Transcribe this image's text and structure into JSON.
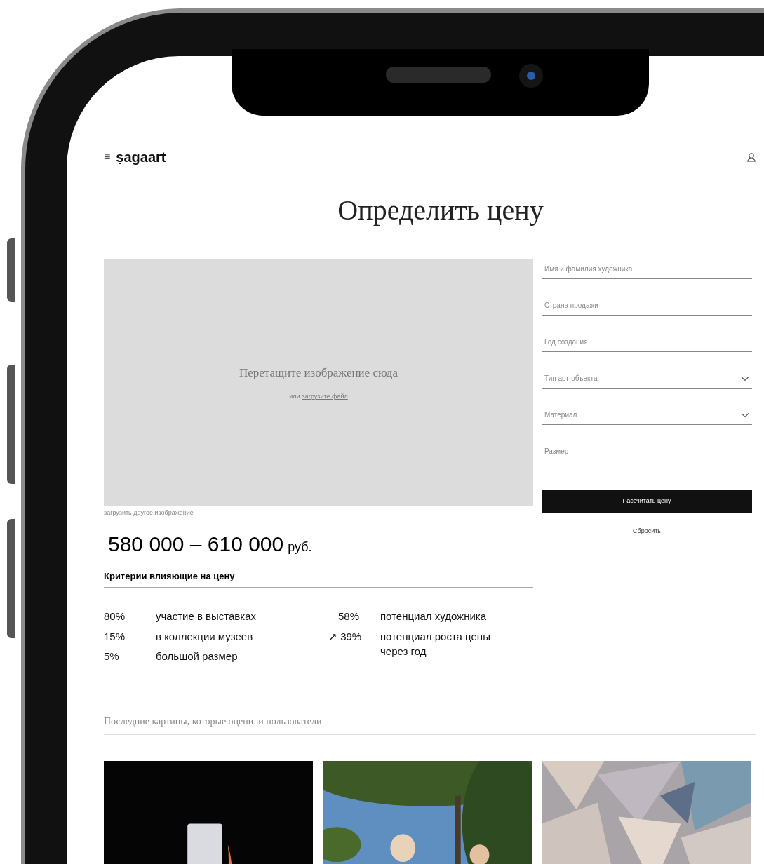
{
  "header": {
    "menu_icon": "≡",
    "logo": "ṣagaart"
  },
  "title": "Определить цену",
  "upload": {
    "prompt": "Перетащите изображение сюда",
    "or_text": "или",
    "link": "загрузите файл",
    "replace_link": "загрузить другое изображение"
  },
  "form": {
    "fields": [
      {
        "kind": "text",
        "placeholder": "Имя и фамилия художника"
      },
      {
        "kind": "text",
        "placeholder": "Страна продажи"
      },
      {
        "kind": "text",
        "placeholder": "Год создания"
      },
      {
        "kind": "select",
        "placeholder": "Тип арт-объекта"
      },
      {
        "kind": "select",
        "placeholder": "Материал"
      },
      {
        "kind": "text",
        "placeholder": "Размер"
      }
    ],
    "submit": "Рассчитать цену",
    "reset": "Сбросить"
  },
  "price": {
    "range": "580 000 – 610 000",
    "currency": "руб."
  },
  "criteria": {
    "heading": "Критерии влияющие на цену",
    "left": [
      {
        "percent": "80%",
        "label": "участие в выставках"
      },
      {
        "percent": "15%",
        "label": "в коллекции музеев"
      },
      {
        "percent": "5%",
        "label": "большой размер"
      }
    ],
    "right": [
      {
        "percent": "58%",
        "label": "потенциал художника"
      },
      {
        "percent": "↗ 39%",
        "label": "потенциал роста цены через год"
      }
    ]
  },
  "recent": {
    "heading": "Последние картины, которые оценили пользователи"
  }
}
